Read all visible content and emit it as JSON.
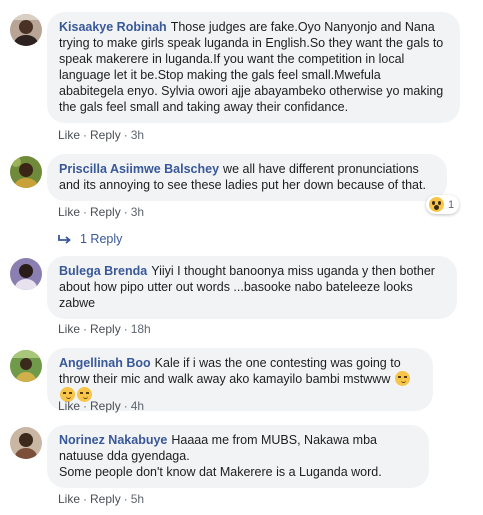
{
  "actions": {
    "like": "Like",
    "reply": "Reply",
    "separator": "·"
  },
  "comments": [
    {
      "author": "Kisaakye Robinah",
      "text": "Those judges are fake.Oyo Nanyonjo and Nana trying to make girls speak luganda in English.So they want the gals to speak makerere in luganda.If you want the competition in local language let it be.Stop making the gals feel small.Mwefula ababitegela enyo. Sylvia owori ajje abayambeko otherwise yo making the gals feel small and taking away their confidance.",
      "time": "3h"
    },
    {
      "author": "Priscilla Asiimwe Balschey",
      "text": "we all have different pronunciations and its annoying to see these ladies put her down because of that.",
      "time": "3h",
      "reaction": {
        "icon": "wow-reaction-icon",
        "count": "1"
      },
      "replies_label": "1 Reply"
    },
    {
      "author": "Bulega Brenda",
      "text": "Yiiyi I thought banoonya miss uganda y then bother about how pipo utter out words ...basooke nabo bateleeze looks zabwe",
      "time": "18h"
    },
    {
      "author": "Angellinah Boo",
      "text": "Kale if i was the one contesting was going to throw their mic and walk away ako kamayilo bambi mstwww",
      "time": "4h",
      "emoji_icons": [
        "smirk-emoji-icon",
        "smirk-emoji-icon",
        "smirk-emoji-icon"
      ]
    },
    {
      "author": "Norinez Nakabuye",
      "text": "Haaaa me from MUBS, Nakawa mba natuuse dda gyendaga.\nSome people don't know dat Makerere is a Luganda word.",
      "time": "5h"
    }
  ]
}
